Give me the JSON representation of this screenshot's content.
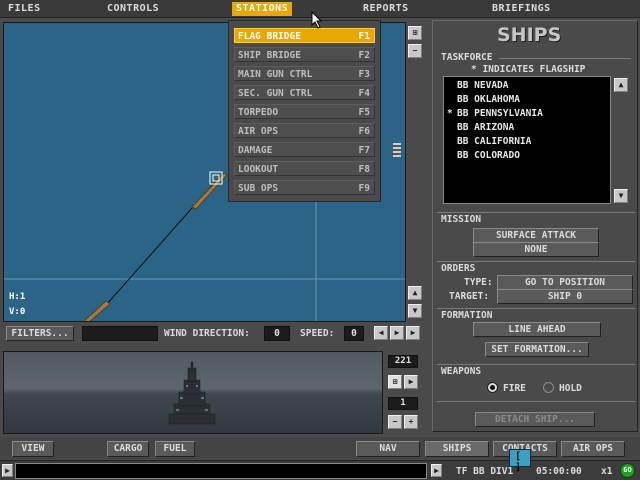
{
  "menubar": {
    "files": "FILES",
    "controls": "CONTROLS",
    "stations": "STATIONS",
    "reports": "REPORTS",
    "briefings": "BRIEFINGS"
  },
  "stations_menu": [
    {
      "label": "FLAG BRIDGE",
      "key": "F1"
    },
    {
      "label": "SHIP BRIDGE",
      "key": "F2"
    },
    {
      "label": "MAIN GUN CTRL",
      "key": "F3"
    },
    {
      "label": "SEC. GUN CTRL",
      "key": "F4"
    },
    {
      "label": "TORPEDO",
      "key": "F5"
    },
    {
      "label": "AIR OPS",
      "key": "F6"
    },
    {
      "label": "DAMAGE",
      "key": "F7"
    },
    {
      "label": "LOOKOUT",
      "key": "F8"
    },
    {
      "label": "SUB OPS",
      "key": "F9"
    }
  ],
  "map": {
    "h_label": "H:1",
    "v_label": "V:0"
  },
  "filterbar": {
    "filters_label": "FILTERS...",
    "wind_label": "WIND DIRECTION:",
    "wind_value": "0",
    "speed_label": "SPEED:",
    "speed_value": "0"
  },
  "viewer": {
    "heading_value": "221",
    "zoom_value": "1"
  },
  "ships_panel": {
    "title": "SHIPS",
    "taskforce_title": "TASKFORCE",
    "flagship_note": "* INDICATES FLAGSHIP",
    "ships": [
      {
        "flag": "",
        "name": "BB NEVADA"
      },
      {
        "flag": "",
        "name": "BB OKLAHOMA"
      },
      {
        "flag": "*",
        "name": "BB PENNSYLVANIA"
      },
      {
        "flag": "",
        "name": "BB ARIZONA"
      },
      {
        "flag": "",
        "name": "BB CALIFORNIA"
      },
      {
        "flag": "",
        "name": "BB COLORADO"
      }
    ],
    "mission_title": "MISSION",
    "mission_primary": "SURFACE ATTACK",
    "mission_secondary": "NONE",
    "orders_title": "ORDERS",
    "type_label": "TYPE:",
    "type_value": "GO TO POSITION",
    "target_label": "TARGET:",
    "target_value": "SHIP 0",
    "formation_title": "FORMATION",
    "formation_value": "LINE AHEAD",
    "set_formation": "SET FORMATION...",
    "weapons_title": "WEAPONS",
    "fire_label": "FIRE",
    "hold_label": "HOLD",
    "weapons_selected": "FIRE",
    "detach_label": "DETACH SHIP..."
  },
  "bottom_tabs": {
    "view": "VIEW",
    "cargo": "CARGO",
    "fuel": "FUEL",
    "nav": "NAV",
    "ships": "SHIPS",
    "contacts": "CONTACTS",
    "air_ops": "AIR OPS"
  },
  "statusbar": {
    "unit": "TF BB DIV1",
    "clock": "05:00:00",
    "time_scale": "x1",
    "go": "GO"
  },
  "colors": {
    "highlight": "#e8a800",
    "sea": "#2a6486",
    "panel": "#4a4a4a"
  }
}
